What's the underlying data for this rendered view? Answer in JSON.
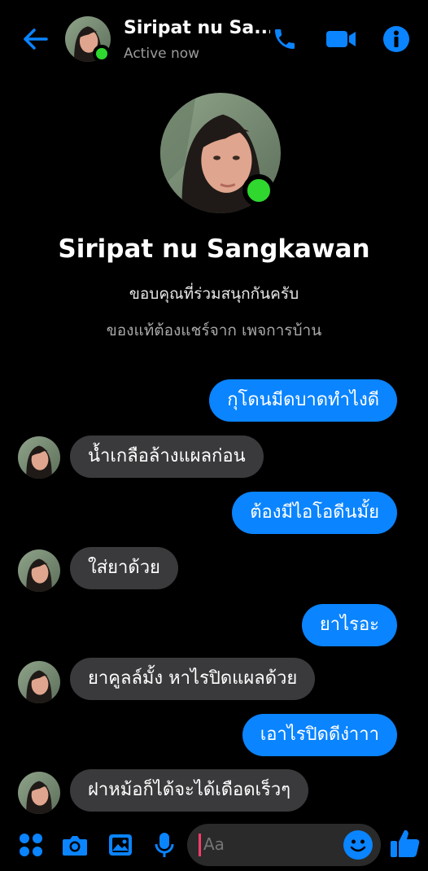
{
  "header": {
    "contact_name": "Siripat nu Sa...",
    "status": "Active now"
  },
  "profile": {
    "name": "Siripat nu Sangkawan",
    "line1": "ขอบคุณที่ร่วมสนุกกันครับ",
    "line2": "ของแท้ต้องแชร์จาก เพจการบ้าน"
  },
  "messages": [
    {
      "side": "sent",
      "text": "กุโดนมีดบาดทำไงดี"
    },
    {
      "side": "received",
      "text": "น้ำเกลือล้างแผลก่อน"
    },
    {
      "side": "sent",
      "text": "ต้องมีไอโอดีนมั้ย"
    },
    {
      "side": "received",
      "text": "ใส่ยาด้วย"
    },
    {
      "side": "sent",
      "text": "ยาไรอะ"
    },
    {
      "side": "received",
      "text": "ยาคูลล์มั้ง หาไรปิดแผลด้วย"
    },
    {
      "side": "sent",
      "text": "เอาไรปิดดีง่าาา"
    },
    {
      "side": "received",
      "text": "ฝาหม้อก็ได้จะได้เดือดเร็วๆ"
    }
  ],
  "composer": {
    "placeholder": "Aa"
  },
  "colors": {
    "accent": "#0a84ff",
    "online": "#2fd72f",
    "received_bubble": "#3a3a3c",
    "background": "#000000"
  },
  "icons": {
    "back": "arrow-left-icon",
    "call": "phone-icon",
    "video": "video-camera-icon",
    "info": "info-icon",
    "menu": "four-dots-icon",
    "camera": "camera-icon",
    "gallery": "image-icon",
    "mic": "microphone-icon",
    "emoji": "smiley-icon",
    "like": "thumbs-up-icon"
  }
}
